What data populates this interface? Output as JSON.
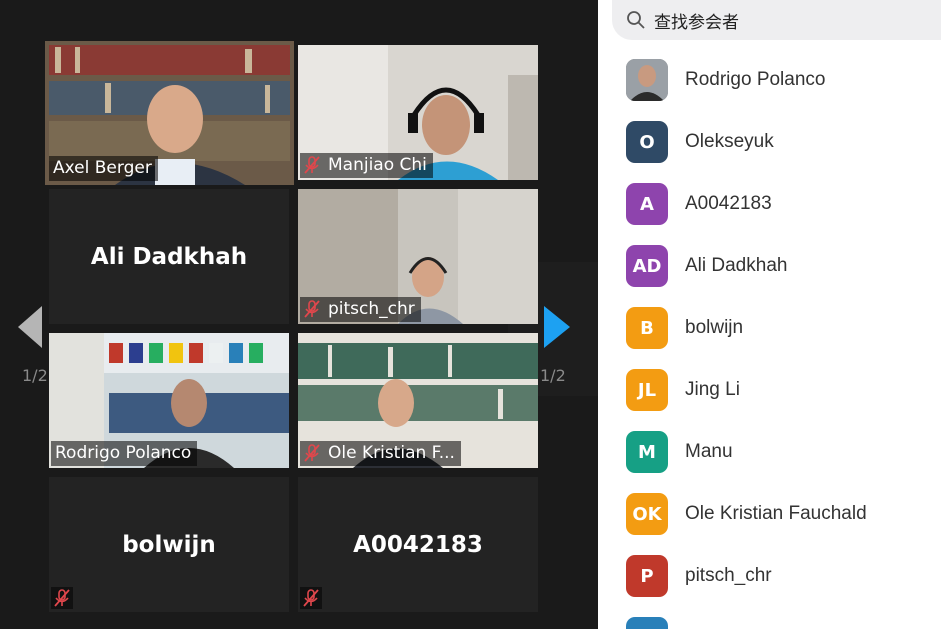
{
  "gallery": {
    "page_indicator_left": "1/2",
    "page_indicator_right": "1/2",
    "tiles": [
      {
        "name": "Axel Berger",
        "type": "video",
        "muted": false,
        "active_speaker": true
      },
      {
        "name": "Manjiao Chi",
        "type": "video",
        "muted": true
      },
      {
        "name": "Ali Dadkhah",
        "type": "name-only",
        "muted": false
      },
      {
        "name": "pitsch_chr",
        "type": "video",
        "muted": true
      },
      {
        "name": "Rodrigo Polanco",
        "type": "video",
        "muted": false
      },
      {
        "name": "Ole Kristian F...",
        "type": "video",
        "muted": true
      },
      {
        "name": "bolwijn",
        "type": "name-only",
        "muted": true
      },
      {
        "name": "A0042183",
        "type": "name-only",
        "muted": true
      }
    ]
  },
  "participants": {
    "search_placeholder": "查找参会者",
    "list": [
      {
        "initials": "",
        "name": "Rodrigo Polanco",
        "color": "#8a8a8a",
        "photo": true
      },
      {
        "initials": "O",
        "name": "Olekseyuk",
        "color": "#2f4a66"
      },
      {
        "initials": "A",
        "name": "A0042183",
        "color": "#8e44ad"
      },
      {
        "initials": "AD",
        "name": "Ali Dadkhah",
        "color": "#8e44ad"
      },
      {
        "initials": "B",
        "name": "bolwijn",
        "color": "#f39c12"
      },
      {
        "initials": "JL",
        "name": "Jing Li",
        "color": "#f39c12"
      },
      {
        "initials": "M",
        "name": "Manu",
        "color": "#16a085"
      },
      {
        "initials": "OK",
        "name": "Ole Kristian Fauchald",
        "color": "#f39c12"
      },
      {
        "initials": "P",
        "name": "pitsch_chr",
        "color": "#c0392b"
      }
    ]
  },
  "colors": {
    "active_border": "#d7f06d",
    "next_arrow": "#1da1f2",
    "mute_icon": "#e0474c"
  }
}
